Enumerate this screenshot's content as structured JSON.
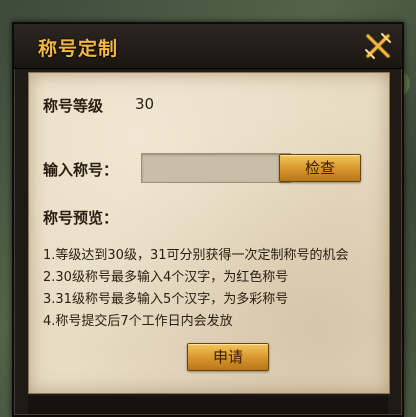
{
  "dialog": {
    "title": "称号定制",
    "close_icon": "crossed-swords-close-icon"
  },
  "level": {
    "label": "称号等级",
    "value": "30"
  },
  "input": {
    "label": "输入称号：",
    "value": "",
    "placeholder": ""
  },
  "check_button": {
    "label": "检查"
  },
  "preview": {
    "label": "称号预览："
  },
  "rules": [
    "1.等级达到30级，31可分别获得一次定制称号的机会",
    "2.30级称号最多输入4个汉字，为红色称号",
    "3.31级称号最多输入5个汉字，为多彩称号",
    "4.称号提交后7个工作日内会发放"
  ],
  "apply_button": {
    "label": "申请"
  },
  "colors": {
    "title": "#f0b842",
    "parchment": "#e8dcc4",
    "button": "#d6952a",
    "text": "#2a1d10"
  }
}
